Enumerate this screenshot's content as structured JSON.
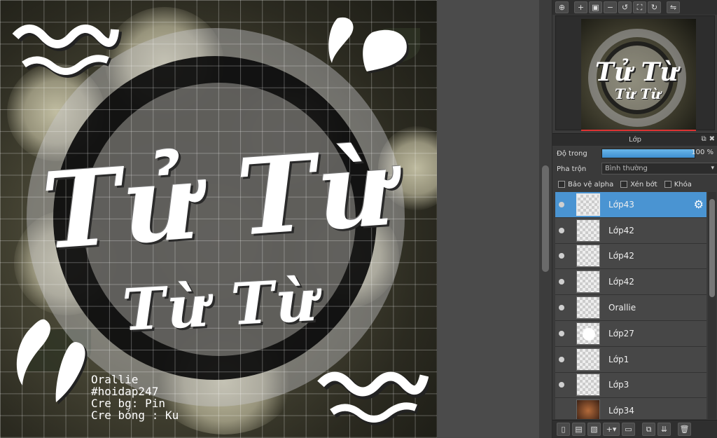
{
  "canvas": {
    "title_main": "Tử Từ",
    "title_sub": "Từ Từ",
    "credits": [
      "Orallie",
      "#hoidap247",
      "Cre bg: Pin",
      "Cre bóng : Ku"
    ]
  },
  "navigator_toolbar": {
    "icons": [
      "zoom-fit-icon",
      "zoom-in-icon",
      "fit-window-icon",
      "zoom-out-icon",
      "rotate-left-icon",
      "fullscreen-icon",
      "rotate-right-icon",
      "flip-icon"
    ]
  },
  "layer_panel": {
    "header_title": "Lớp",
    "opacity_label": "Độ trong",
    "opacity_value": "100 %",
    "opacity_fraction": 1.0,
    "blend_label": "Pha trộn",
    "blend_value": "Bình thường",
    "checkbox_alpha": "Bảo vệ alpha",
    "checkbox_clip": "Xén bớt",
    "checkbox_lock": "Khóa",
    "layers": [
      {
        "name": "Lớp43",
        "selected": true
      },
      {
        "name": "Lớp42"
      },
      {
        "name": "Lớp42"
      },
      {
        "name": "Lớp42"
      },
      {
        "name": "Orallie"
      },
      {
        "name": "Lớp27"
      },
      {
        "name": "Lớp1"
      },
      {
        "name": "Lớp3"
      },
      {
        "name": "Lớp34"
      }
    ]
  },
  "colors": {
    "selection": "#4a94d2",
    "panel_bg": "#3a3a3a",
    "opacity_fill": "#5aa8e2"
  }
}
